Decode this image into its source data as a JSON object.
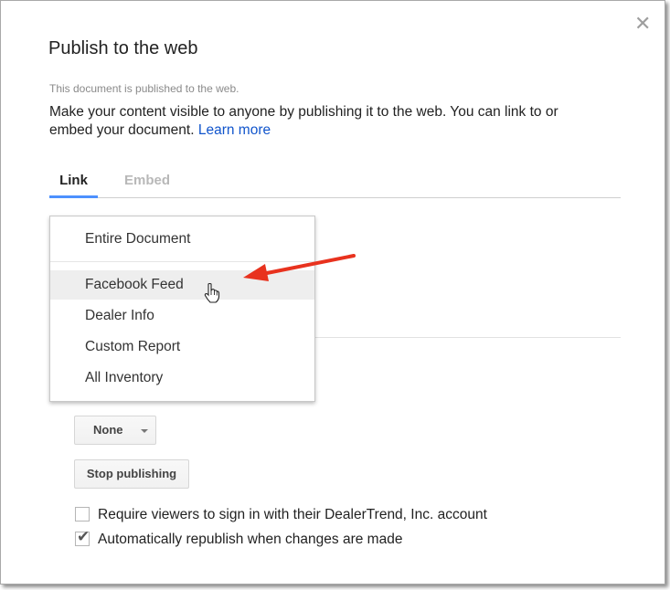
{
  "dialog": {
    "title": "Publish to the web",
    "close_symbol": "✕",
    "status": "This document is published to the web.",
    "description": "Make your content visible to anyone by publishing it to the web. You can link to or embed your document.",
    "learn_more": "Learn more"
  },
  "tabs": [
    {
      "label": "Link",
      "active": true
    },
    {
      "label": "Embed",
      "active": false
    }
  ],
  "dropdown_menu": {
    "items": [
      {
        "label": "Entire Document"
      },
      {
        "label": "Facebook Feed",
        "highlighted": true
      },
      {
        "label": "Dealer Info"
      },
      {
        "label": "Custom Report"
      },
      {
        "label": "All Inventory"
      }
    ]
  },
  "controls": {
    "format_select_value": "None",
    "stop_publishing_label": "Stop publishing"
  },
  "options": {
    "require_signin": {
      "label": "Require viewers to sign in with their DealerTrend, Inc. account",
      "checked": false
    },
    "auto_republish": {
      "label": "Automatically republish when changes are made",
      "checked": true
    }
  },
  "colors": {
    "link": "#1155cc",
    "tab_indicator": "#4d90fe",
    "annotation_arrow": "#e8321e"
  },
  "icons": {
    "close": "close-icon",
    "dropdown_caret": "chevron-down-icon",
    "check": "checkmark-icon",
    "pointer": "hand-cursor-icon",
    "annotation": "red-arrow-annotation"
  }
}
